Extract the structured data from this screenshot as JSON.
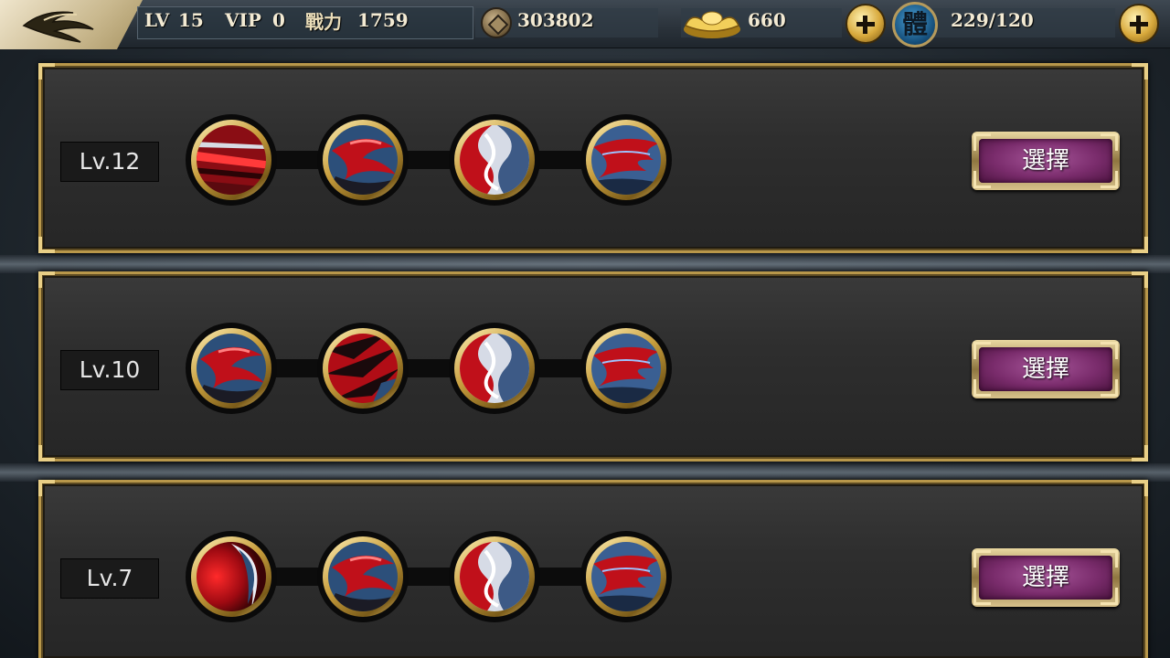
{
  "hud": {
    "lv_label": "LV",
    "lv_value": "15",
    "vip_label": "VIP",
    "vip_value": "0",
    "power_label": "戰力",
    "power_value": "1759",
    "coins": "303802",
    "ingots": "660",
    "stamina_glyph": "體",
    "stamina": "229/120"
  },
  "rows": [
    {
      "level": "Lv.12",
      "select_label": "選擇",
      "skills": [
        "slash-red-streak",
        "red-swirl-claw",
        "yin-yang-red",
        "red-blue-flow"
      ]
    },
    {
      "level": "Lv.10",
      "select_label": "選擇",
      "skills": [
        "red-swirl-claw",
        "red-dark-spikes",
        "yin-yang-red",
        "red-blue-flow"
      ]
    },
    {
      "level": "Lv.7",
      "select_label": "選擇",
      "skills": [
        "red-orb-crescent",
        "red-swirl-claw",
        "yin-yang-red",
        "red-blue-flow"
      ]
    }
  ],
  "colors": {
    "gold_frame": "#b8974a",
    "panel_bg": "#2e2e2e",
    "select_button": "#7a2c6c",
    "skill_red": "#c0101a",
    "skill_blue": "#2c4f7a"
  }
}
